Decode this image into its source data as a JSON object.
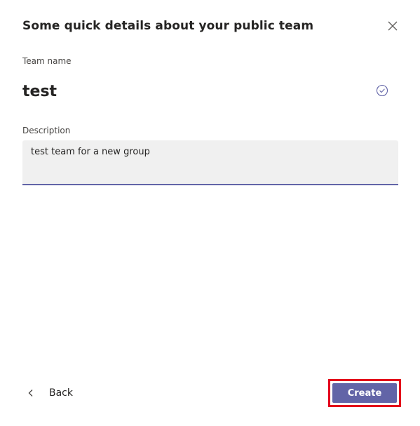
{
  "dialog": {
    "title": "Some quick details about your public team",
    "close_icon": "close-icon"
  },
  "team_name": {
    "label": "Team name",
    "value": "test",
    "status_icon": "check-circle-icon"
  },
  "description": {
    "label": "Description",
    "value": "test team for a new group"
  },
  "footer": {
    "back_label": "Back",
    "back_icon": "chevron-left-icon",
    "create_label": "Create"
  },
  "colors": {
    "accent": "#6264a7",
    "highlight": "#e3001b",
    "field_bg": "#f0f0f0",
    "text": "#252423"
  }
}
